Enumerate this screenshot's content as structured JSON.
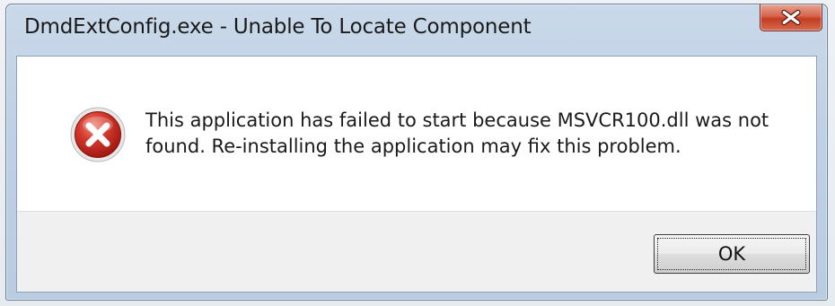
{
  "window": {
    "title": "DmdExtConfig.exe - Unable To Locate Component"
  },
  "message": {
    "text": "This application has failed to start because MSVCR100.dll was not\nfound. Re-installing the application may fix this problem.",
    "icon": "error-icon"
  },
  "buttons": {
    "ok_label": "OK",
    "close_icon": "close-icon"
  },
  "colors": {
    "close_button": "#c33d22",
    "error_icon": "#c8241c"
  }
}
